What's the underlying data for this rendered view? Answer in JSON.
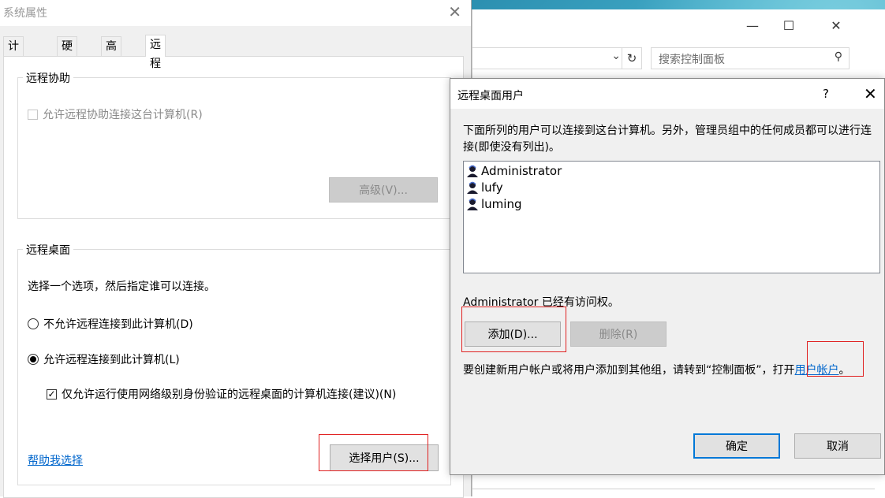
{
  "colors": {
    "accent": "#0078d7",
    "link": "#0066cc",
    "highlight_box": "#e02020"
  },
  "control_panel": {
    "search_placeholder": "搜索控制面板",
    "icons": {
      "minimize": "minimize-icon",
      "maximize": "maximize-icon",
      "close": "close-icon",
      "dropdown": "chevron-down-icon",
      "refresh": "refresh-icon",
      "search": "search-icon"
    }
  },
  "system_properties": {
    "title": "系统属性",
    "tabs": [
      {
        "label": "计算机名",
        "active": false
      },
      {
        "label": "硬件",
        "active": false
      },
      {
        "label": "高级",
        "active": false
      },
      {
        "label": "远程",
        "active": true
      }
    ],
    "remote_assistance": {
      "group_label": "远程协助",
      "allow_checkbox": {
        "label": "允许远程协助连接这台计算机(R)",
        "checked": false,
        "enabled": false
      },
      "advanced_button": "高级(V)..."
    },
    "remote_desktop": {
      "group_label": "远程桌面",
      "instruction": "选择一个选项，然后指定谁可以连接。",
      "option_deny": {
        "label": "不允许远程连接到此计算机(D)",
        "selected": false
      },
      "option_allow": {
        "label": "允许远程连接到此计算机(L)",
        "selected": true
      },
      "nla_checkbox": {
        "label": "仅允许运行使用网络级别身份验证的远程桌面的计算机连接(建议)(N)",
        "checked": true
      },
      "help_link": "帮助我选择",
      "select_users_button": "选择用户(S)..."
    }
  },
  "remote_desktop_users": {
    "title": "远程桌面用户",
    "help_glyph": "?",
    "description": "下面所列的用户可以连接到这台计算机。另外，管理员组中的任何成员都可以进行连接(即使没有列出)。",
    "users": [
      "Administrator",
      "lufy",
      "luming"
    ],
    "status": "Administrator 已经有访问权。",
    "add_button": "添加(D)...",
    "remove_button": "删除(R)",
    "info_text": "要创建新用户帐户或将用户添加到其他组，请转到“控制面板”，打开",
    "user_accounts_link": "用户帐户",
    "info_suffix": "。",
    "ok_button": "确定",
    "cancel_button": "取消"
  }
}
